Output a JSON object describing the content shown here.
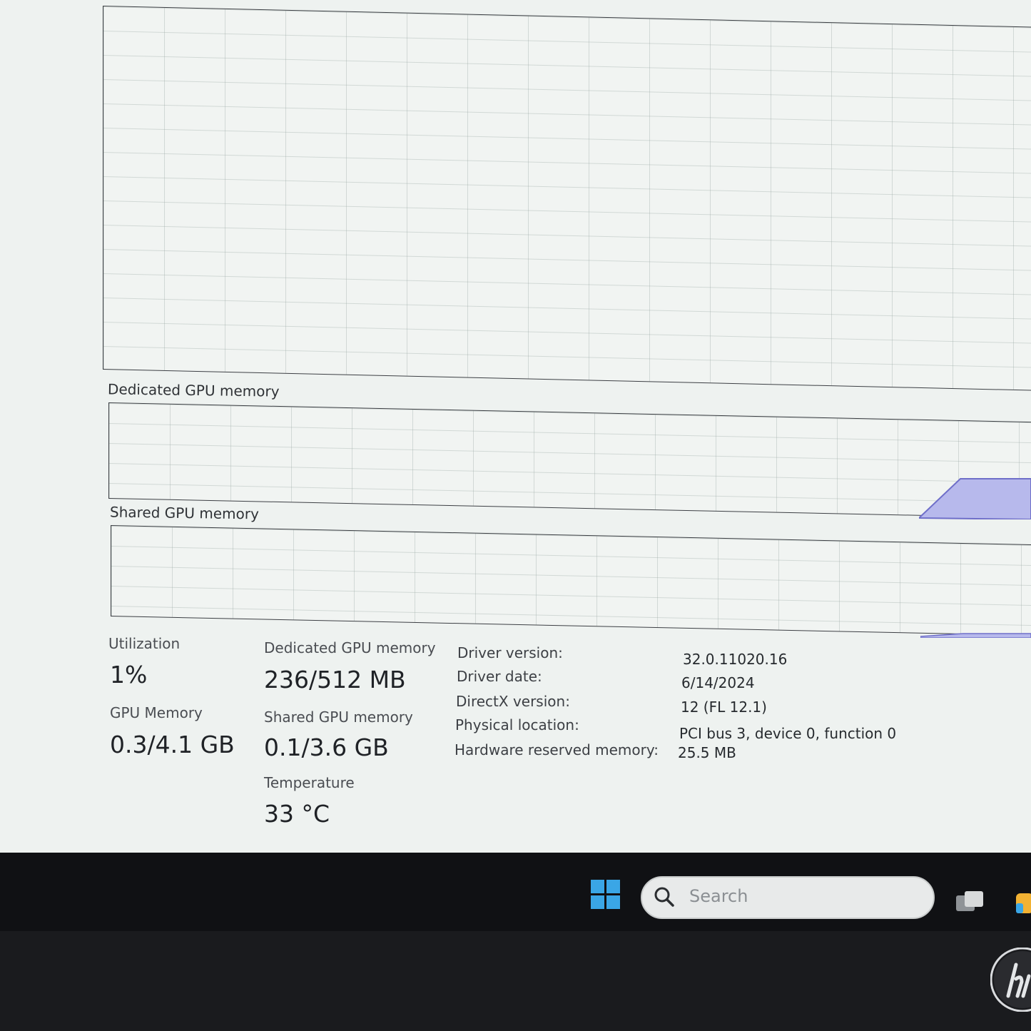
{
  "graphs": {
    "dedicated_label": "Dedicated GPU memory",
    "shared_label": "Shared GPU memory"
  },
  "stats": {
    "utilization_label": "Utilization",
    "utilization_value": "1%",
    "dedicated_label": "Dedicated GPU memory",
    "dedicated_value": "236/512 MB",
    "gpu_memory_label": "GPU Memory",
    "gpu_memory_value": "0.3/4.1 GB",
    "shared_label": "Shared GPU memory",
    "shared_value": "0.1/3.6 GB",
    "temperature_label": "Temperature",
    "temperature_value": "33 °C"
  },
  "info": [
    {
      "key": "Driver version:",
      "value": "32.0.11020.16"
    },
    {
      "key": "Driver date:",
      "value": "6/14/2024"
    },
    {
      "key": "DirectX version:",
      "value": "12 (FL 12.1)"
    },
    {
      "key": "Physical location:",
      "value": "PCI bus 3, device 0, function 0"
    },
    {
      "key": "Hardware reserved memory:",
      "value": "25.5 MB"
    }
  ],
  "taskbar": {
    "search_placeholder": "Search",
    "accent": "#3aa6e6"
  },
  "colors": {
    "memory_fill": "#b7b9ec",
    "memory_stroke": "#6f6fc9"
  }
}
